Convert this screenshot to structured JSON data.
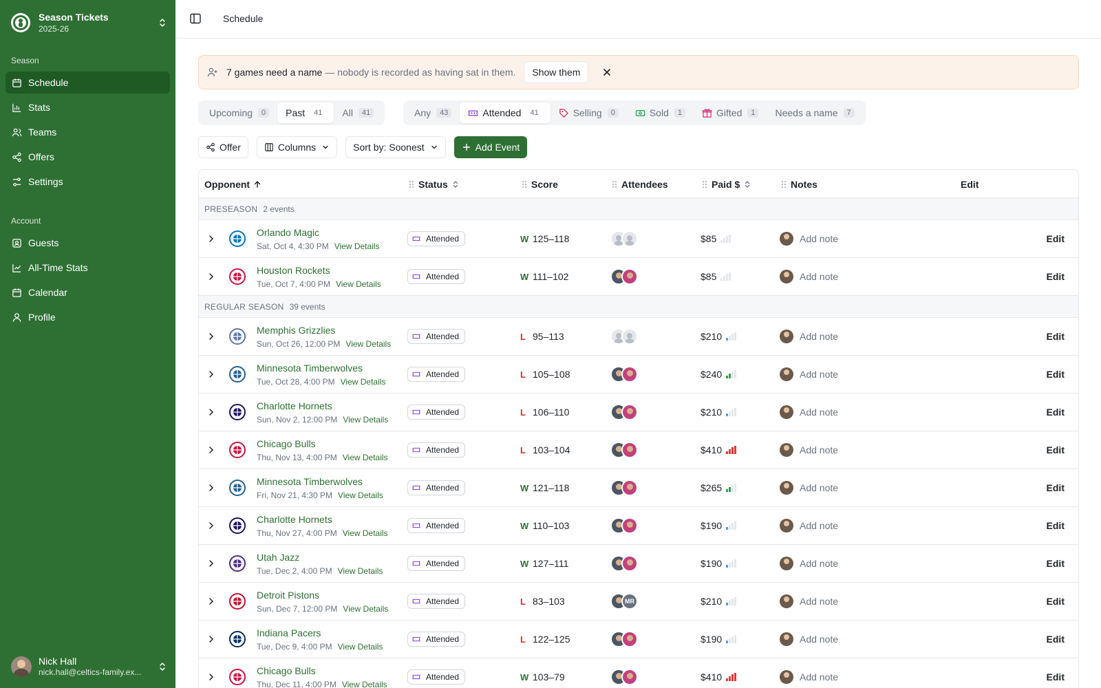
{
  "sidebar": {
    "team_name": "Season Tickets",
    "team_season": "2025-26",
    "section_season": "Season",
    "season_items": [
      {
        "label": "Schedule",
        "icon": "calendar-icon",
        "active": true
      },
      {
        "label": "Stats",
        "icon": "bar-chart-icon"
      },
      {
        "label": "Teams",
        "icon": "users-icon"
      },
      {
        "label": "Offers",
        "icon": "share-icon"
      },
      {
        "label": "Settings",
        "icon": "sliders-icon"
      }
    ],
    "section_account": "Account",
    "account_items": [
      {
        "label": "Guests",
        "icon": "contact-icon"
      },
      {
        "label": "All-Time Stats",
        "icon": "line-chart-icon"
      },
      {
        "label": "Calendar",
        "icon": "calendar-icon"
      },
      {
        "label": "Profile",
        "icon": "user-icon"
      }
    ],
    "user_name": "Nick Hall",
    "user_email": "nick.hall@celtics-family.ex..."
  },
  "header": {
    "title": "Schedule"
  },
  "banner": {
    "strong": "7 games need a name",
    "muted": "— nobody is recorded as having sat in them.",
    "button": "Show them"
  },
  "time_tabs": [
    {
      "label": "Upcoming",
      "count": "0"
    },
    {
      "label": "Past",
      "count": "41",
      "active": true
    },
    {
      "label": "All",
      "count": "41"
    }
  ],
  "status_tabs": [
    {
      "label": "Any",
      "count": "43"
    },
    {
      "label": "Attended",
      "count": "41",
      "active": true,
      "icon": "ticket-icon"
    },
    {
      "label": "Selling",
      "count": "0",
      "icon": "tag-icon"
    },
    {
      "label": "Sold",
      "count": "1",
      "icon": "banknote-icon"
    },
    {
      "label": "Gifted",
      "count": "1",
      "icon": "gift-icon"
    },
    {
      "label": "Needs a name",
      "count": "7"
    }
  ],
  "toolbar": {
    "offer": "Offer",
    "columns": "Columns",
    "sort": "Sort by: Soonest",
    "add_event": "Add Event"
  },
  "columns": {
    "opponent": "Opponent",
    "status": "Status",
    "score": "Score",
    "attendees": "Attendees",
    "paid": "Paid $",
    "notes": "Notes",
    "edit": "Edit"
  },
  "groups": [
    {
      "label": "PRESEASON",
      "count": "2 events",
      "rows": [
        {
          "team": "Orlando Magic",
          "date": "Sat, Oct 4, 4:30 PM",
          "status": "Attended",
          "result": "W",
          "score": "125–118",
          "attendees": "none",
          "paid": "$85",
          "level": 0,
          "logo_color": "#0077c0"
        },
        {
          "team": "Houston Rockets",
          "date": "Tue, Oct 7, 4:00 PM",
          "status": "Attended",
          "result": "W",
          "score": "111–102",
          "attendees": "pair",
          "paid": "$85",
          "level": 0,
          "logo_color": "#ce1141"
        }
      ]
    },
    {
      "label": "REGULAR SEASON",
      "count": "39 events",
      "rows": [
        {
          "team": "Memphis Grizzlies",
          "date": "Sun, Oct 26, 12:00 PM",
          "status": "Attended",
          "result": "L",
          "score": "95–113",
          "attendees": "none",
          "paid": "$210",
          "level": 1,
          "logo_color": "#5d76a9"
        },
        {
          "team": "Minnesota Timberwolves",
          "date": "Tue, Oct 28, 4:00 PM",
          "status": "Attended",
          "result": "L",
          "score": "105–108",
          "attendees": "pair",
          "paid": "$240",
          "level": 2,
          "logo_color": "#236192"
        },
        {
          "team": "Charlotte Hornets",
          "date": "Sun, Nov 2, 12:00 PM",
          "status": "Attended",
          "result": "L",
          "score": "106–110",
          "attendees": "pair",
          "paid": "$210",
          "level": 1,
          "logo_color": "#1d1160"
        },
        {
          "team": "Chicago Bulls",
          "date": "Thu, Nov 13, 4:00 PM",
          "status": "Attended",
          "result": "L",
          "score": "103–104",
          "attendees": "pair",
          "paid": "$410",
          "level": 4,
          "logo_color": "#ce1141"
        },
        {
          "team": "Minnesota Timberwolves",
          "date": "Fri, Nov 21, 4:30 PM",
          "status": "Attended",
          "result": "W",
          "score": "121–118",
          "attendees": "pair",
          "paid": "$265",
          "level": 2,
          "logo_color": "#236192"
        },
        {
          "team": "Charlotte Hornets",
          "date": "Thu, Nov 27, 4:00 PM",
          "status": "Attended",
          "result": "W",
          "score": "110–103",
          "attendees": "pair",
          "paid": "$190",
          "level": 1,
          "logo_color": "#1d1160"
        },
        {
          "team": "Utah Jazz",
          "date": "Tue, Dec 2, 4:00 PM",
          "status": "Attended",
          "result": "W",
          "score": "127–111",
          "attendees": "pair",
          "paid": "$190",
          "level": 1,
          "logo_color": "#4b2a84"
        },
        {
          "team": "Detroit Pistons",
          "date": "Sun, Dec 7, 12:00 PM",
          "status": "Attended",
          "result": "L",
          "score": "83–103",
          "attendees": "mr",
          "paid": "$210",
          "level": 1,
          "logo_color": "#c8102e"
        },
        {
          "team": "Indiana Pacers",
          "date": "Tue, Dec 9, 4:00 PM",
          "status": "Attended",
          "result": "L",
          "score": "122–125",
          "attendees": "pair",
          "paid": "$190",
          "level": 1,
          "logo_color": "#002d62"
        },
        {
          "team": "Chicago Bulls",
          "date": "Thu, Dec 11, 4:00 PM",
          "status": "Attended",
          "result": "W",
          "score": "103–79",
          "attendees": "pair",
          "paid": "$410",
          "level": 4,
          "logo_color": "#ce1141"
        }
      ]
    }
  ],
  "row_labels": {
    "view_details": "View Details",
    "add_note": "Add note",
    "edit": "Edit",
    "mr_initials": "MR"
  }
}
